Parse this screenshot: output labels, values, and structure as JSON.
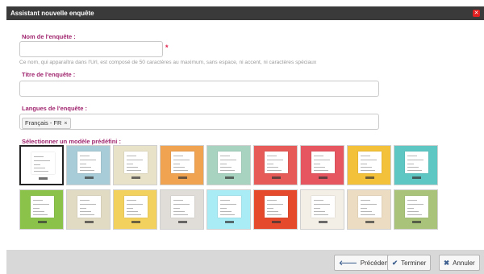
{
  "dialog": {
    "title": "Assistant nouvelle enquête",
    "close_icon": "close-icon"
  },
  "form": {
    "name_label": "Nom de l'enquête :",
    "name_value": "",
    "required_mark": "*",
    "name_hint": "Ce nom, qui apparaîtra dans l'Url, est composé de 50 caractères au maximum, sans espace, ni accent, ni caractères spéciaux",
    "title_label": "Titre de l'enquête :",
    "title_value": "",
    "languages_label": "Langues de l'enquête :",
    "languages": [
      {
        "label": "Français - FR",
        "remove": "×"
      }
    ],
    "template_label": "Sélectionner un modèle prédéfini :"
  },
  "templates": [
    {
      "bg": "#ffffff",
      "selected": true
    },
    {
      "bg": "#a9cdd8"
    },
    {
      "bg": "#e8e2c8"
    },
    {
      "bg": "#f0a350"
    },
    {
      "bg": "#a7d3c0"
    },
    {
      "bg": "#e65b57"
    },
    {
      "bg": "#e55660"
    },
    {
      "bg": "#f3c23a"
    },
    {
      "bg": "#5fc7c3"
    },
    {
      "bg": "#8bc34a"
    },
    {
      "bg": "#e2dbc4"
    },
    {
      "bg": "#f3d15f"
    },
    {
      "bg": "#e0ddd8"
    },
    {
      "bg": "#a9ecf5"
    },
    {
      "bg": "#e54a2c"
    },
    {
      "bg": "#f3efe6"
    },
    {
      "bg": "#ecdcc2"
    },
    {
      "bg": "#a9c47a"
    }
  ],
  "footer": {
    "previous_label": "Précédent",
    "previous_icon": "arrow-left-icon",
    "finish_label": "Terminer",
    "finish_icon": "check-icon",
    "cancel_label": "Annuler",
    "cancel_icon": "x-icon"
  }
}
